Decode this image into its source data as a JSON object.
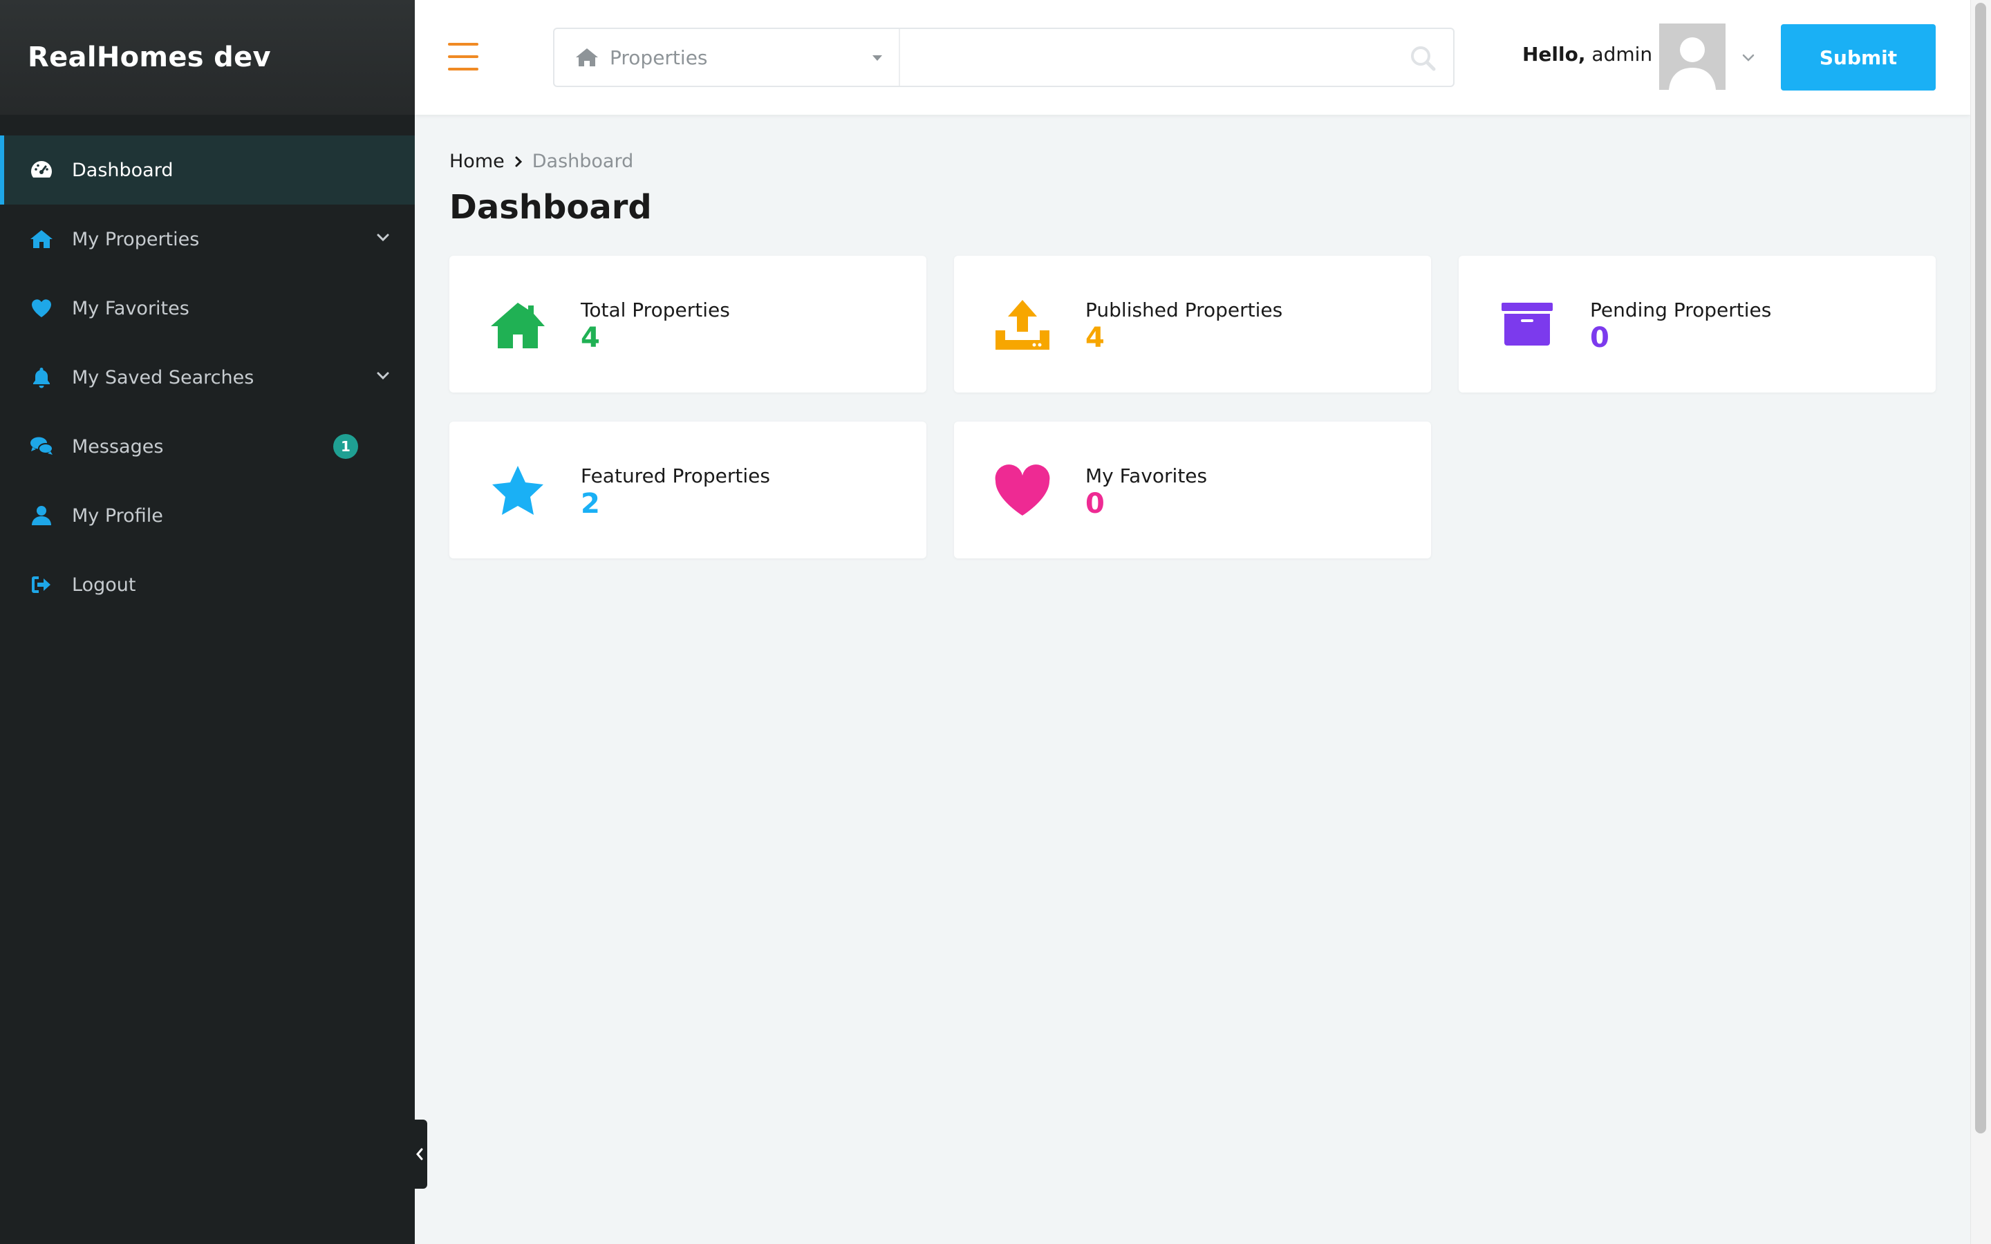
{
  "brand": {
    "title": "RealHomes dev"
  },
  "sidebar": {
    "items": [
      {
        "label": "Dashboard"
      },
      {
        "label": "My Properties"
      },
      {
        "label": "My Favorites"
      },
      {
        "label": "My Saved Searches"
      },
      {
        "label": "Messages",
        "badge": "1"
      },
      {
        "label": "My Profile"
      },
      {
        "label": "Logout"
      }
    ]
  },
  "header": {
    "search_type": "Properties",
    "search_placeholder": "",
    "greeting_bold": "Hello,",
    "greeting_user": "admin",
    "submit_label": "Submit"
  },
  "breadcrumb": {
    "home": "Home",
    "current": "Dashboard"
  },
  "page": {
    "title": "Dashboard"
  },
  "cards": [
    {
      "label": "Total Properties",
      "value": "4",
      "icon": "house-icon",
      "color": "#20b154"
    },
    {
      "label": "Published Properties",
      "value": "4",
      "icon": "upload-icon",
      "color": "#f7a600"
    },
    {
      "label": "Pending Properties",
      "value": "0",
      "icon": "archive-icon",
      "color": "#7c3aed"
    },
    {
      "label": "Featured Properties",
      "value": "2",
      "icon": "star-icon",
      "color": "#1ab0f5"
    },
    {
      "label": "My Favorites",
      "value": "0",
      "icon": "heart-icon",
      "color": "#ee2a93"
    }
  ],
  "colors": {
    "accent": "#1ab0f5",
    "sidebar_bg": "#1d2122",
    "hamburger": "#f08a24",
    "badge": "#1fa093"
  }
}
